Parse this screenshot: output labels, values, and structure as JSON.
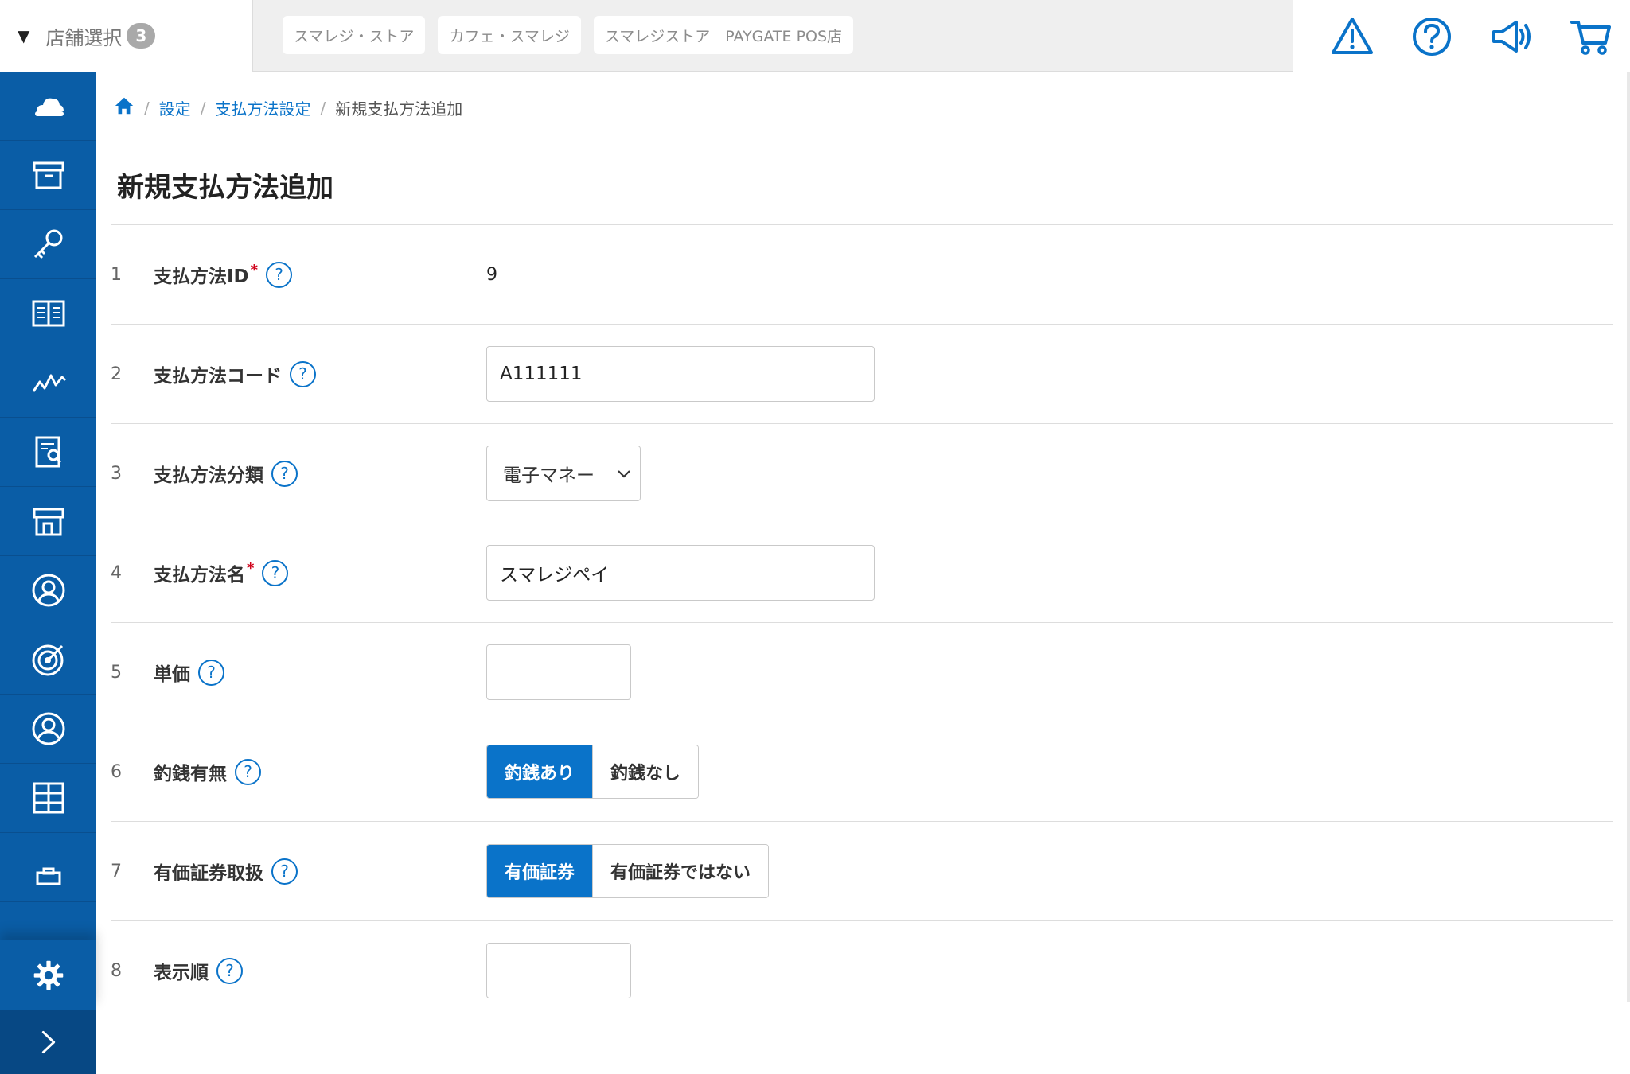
{
  "header": {
    "store_select_label": "店舗選択",
    "store_count": "3",
    "store_tabs": [
      "スマレジ・ストア",
      "カフェ・スマレジ",
      "スマレジストア　PAYGATE POS店"
    ],
    "icons": [
      "warning-icon",
      "help-circle-icon",
      "megaphone-icon",
      "cart-icon"
    ],
    "accent_color": "#0a73c9"
  },
  "sidebar": {
    "background": "#0a5da6",
    "items": [
      "cloud-icon",
      "archive-box-icon",
      "key-icon",
      "book-icon",
      "line-chart-icon",
      "report-search-icon",
      "store-icon",
      "customer-icon",
      "target-icon",
      "user-icon",
      "grid-icon",
      "clipboard-icon"
    ],
    "settings_icon": "gear-icon",
    "expand_icon": "chevron-right-icon"
  },
  "breadcrumb": {
    "home_icon": "home-icon",
    "items": [
      "設定",
      "支払方法設定"
    ],
    "current": "新規支払方法追加"
  },
  "page_title": "新規支払方法追加",
  "form": {
    "rows": [
      {
        "num": "1",
        "label": "支払方法ID",
        "required": "*",
        "value": "9"
      },
      {
        "num": "2",
        "label": "支払方法コード",
        "value": "A111111"
      },
      {
        "num": "3",
        "label": "支払方法分類",
        "selected": "電子マネー"
      },
      {
        "num": "4",
        "label": "支払方法名",
        "required": "*",
        "value": "スマレジペイ"
      },
      {
        "num": "5",
        "label": "単価",
        "value": ""
      },
      {
        "num": "6",
        "label": "釣銭有無",
        "options": [
          "釣銭あり",
          "釣銭なし"
        ],
        "selected_index": 0
      },
      {
        "num": "7",
        "label": "有価証券取扱",
        "options": [
          "有価証券",
          "有価証券ではない"
        ],
        "selected_index": 0
      },
      {
        "num": "8",
        "label": "表示順",
        "value": ""
      }
    ],
    "help_label": "?"
  }
}
